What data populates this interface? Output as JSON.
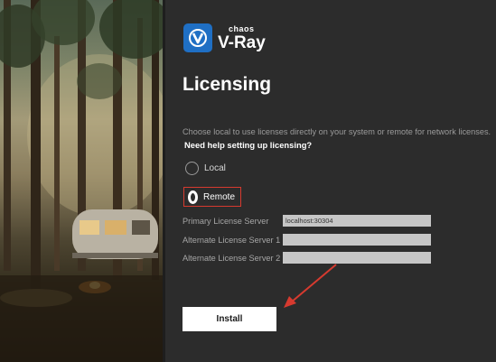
{
  "brand": {
    "small": "chaos",
    "name": "V-Ray"
  },
  "title": "Licensing",
  "description": "Choose local to use licenses directly on your system or remote for network licenses.",
  "help_link": "Need help setting up licensing?",
  "license_mode": {
    "options": [
      {
        "label": "Local",
        "selected": false
      },
      {
        "label": "Remote",
        "selected": true
      }
    ]
  },
  "servers": {
    "primary": {
      "label": "Primary License Server",
      "value": "localhost:30304"
    },
    "alt1": {
      "label": "Alternate License Server 1",
      "value": ""
    },
    "alt2": {
      "label": "Alternate License Server 2",
      "value": ""
    }
  },
  "install_label": "Install",
  "colors": {
    "accent": "#1f6fc4",
    "highlight": "#d63a2f",
    "panel": "#2c2c2c"
  },
  "icons": {
    "brand": "vray-logo-icon",
    "annotation": "red-arrow-icon"
  }
}
